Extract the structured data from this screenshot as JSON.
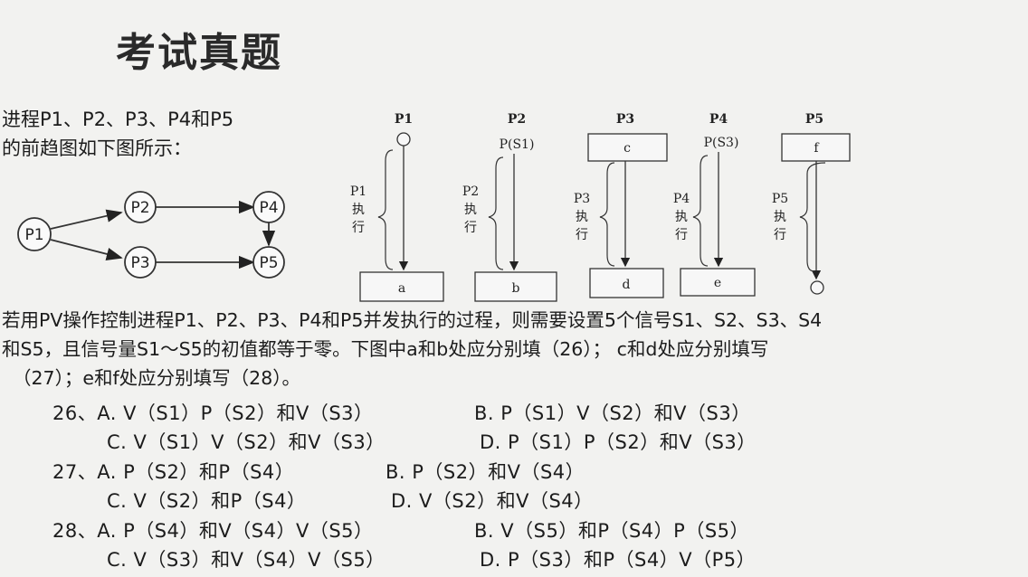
{
  "title": "考试真题",
  "intro": {
    "line1": "进程P1、P2、P3、P4和P5",
    "line2": "的前趋图如下图所示："
  },
  "precedence_graph": {
    "nodes": [
      "P1",
      "P2",
      "P3",
      "P4",
      "P5"
    ],
    "edges": [
      [
        "P1",
        "P2"
      ],
      [
        "P1",
        "P3"
      ],
      [
        "P2",
        "P4"
      ],
      [
        "P3",
        "P5"
      ],
      [
        "P4",
        "P5"
      ]
    ]
  },
  "exec_diagram": {
    "processes": [
      {
        "name": "P1",
        "top": "",
        "exec_label": [
          "P1",
          "执",
          "行"
        ],
        "bottom": "a"
      },
      {
        "name": "P2",
        "top": "P(S1)",
        "exec_label": [
          "P2",
          "执",
          "行"
        ],
        "bottom": "b"
      },
      {
        "name": "P3",
        "top": "c",
        "exec_label": [
          "P3",
          "执",
          "行"
        ],
        "bottom": "d"
      },
      {
        "name": "P4",
        "top": "P(S3)",
        "exec_label": [
          "P4",
          "执",
          "行"
        ],
        "bottom": "e"
      },
      {
        "name": "P5",
        "top": "f",
        "exec_label": [
          "P5",
          "执",
          "行"
        ],
        "bottom": ""
      }
    ]
  },
  "pv_text": {
    "line1": "若用PV操作控制进程P1、P2、P3、P4和P5并发执行的过程，则需要设置5个信号S1、S2、S3、S4",
    "line2": "和S5，且信号量S1～S5的初值都等于零。下图中a和b处应分别填（26）； c和d处应分别填写",
    "line3": "（27）；e和f处应分别填写（28）。"
  },
  "questions": {
    "q26": {
      "A": "26、A. V（S1）P（S2）和V（S3）",
      "B": "B. P（S1）V（S2）和V（S3）",
      "C": "C. V（S1）V（S2）和V（S3）",
      "D": "D. P（S1）P（S2）和V（S3）"
    },
    "q27": {
      "A": "27、A. P（S2）和P（S4）",
      "B": "B. P（S2）和V（S4）",
      "C": "C. V（S2）和P（S4）",
      "D": "D. V（S2）和V（S4）"
    },
    "q28": {
      "A": "28、A. P（S4）和V（S4）V（S5）",
      "B": "B. V（S5）和P（S4）P（S5）",
      "C": "C. V（S3）和V（S4）V（S5）",
      "D": "D. P（S3）和P（S4）V（P5）"
    }
  }
}
